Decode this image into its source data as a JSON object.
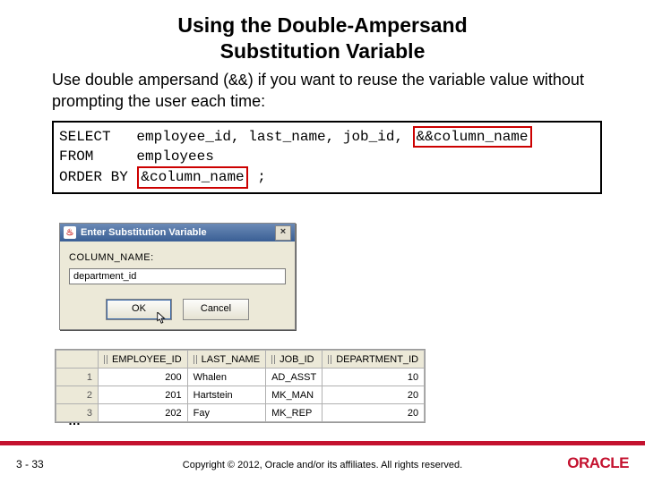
{
  "title_line1": "Using the Double-Ampersand",
  "title_line2": "Substitution Variable",
  "body_pre": "Use double ampersand (",
  "body_code": "&&",
  "body_post": ") if you want to reuse the variable value without prompting the user each time:",
  "sql": {
    "l1a": "SELECT   employee_id, last_name, job_id, ",
    "l1b": "&&column_name",
    "l2": "FROM     employees",
    "l3a": "ORDER BY ",
    "l3b": "&column_name",
    "l3c": " ;"
  },
  "dialog": {
    "title": "Enter Substitution Variable",
    "close": "×",
    "label": "COLUMN_NAME:",
    "value": "department_id",
    "ok": "OK",
    "cancel": "Cancel"
  },
  "table": {
    "cols": [
      "EMPLOYEE_ID",
      "LAST_NAME",
      "JOB_ID",
      "DEPARTMENT_ID"
    ],
    "rows": [
      {
        "n": "1",
        "emp": "200",
        "last": "Whalen",
        "job": "AD_ASST",
        "dept": "10"
      },
      {
        "n": "2",
        "emp": "201",
        "last": "Hartstein",
        "job": "MK_MAN",
        "dept": "20"
      },
      {
        "n": "3",
        "emp": "202",
        "last": "Fay",
        "job": "MK_REP",
        "dept": "20"
      }
    ]
  },
  "ellipsis": "…",
  "slide_no": "3 - 33",
  "copyright": "Copyright © 2012, Oracle and/or its affiliates. All rights reserved.",
  "logo": "ORACLE"
}
